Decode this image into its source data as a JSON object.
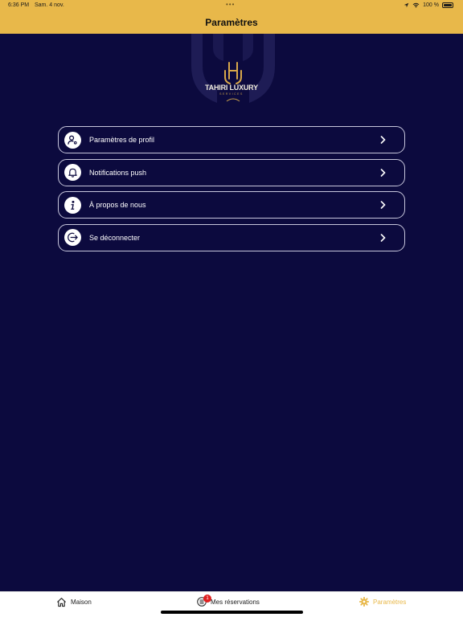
{
  "status": {
    "time": "6:36 PM",
    "date": "Sam. 4 nov.",
    "battery": "100 %",
    "dots": "•••"
  },
  "header": {
    "title": "Paramètres"
  },
  "logo": {
    "name": "TAHIRI LUXURY",
    "subtitle": "SERVICES"
  },
  "menu": [
    {
      "label": "Paramètres de profil",
      "icon": "user-settings-icon"
    },
    {
      "label": "Notifications push",
      "icon": "bell-icon"
    },
    {
      "label": "À propos de nous",
      "icon": "info-icon"
    },
    {
      "label": "Se déconnecter",
      "icon": "logout-icon"
    }
  ],
  "tabs": [
    {
      "label": "Maison",
      "icon": "home-icon"
    },
    {
      "label": "Mes réservations",
      "icon": "list-icon",
      "badge": "1"
    },
    {
      "label": "Paramètres",
      "icon": "gear-icon"
    }
  ],
  "colors": {
    "accent": "#e8b84a",
    "background": "#0c0a3e"
  }
}
